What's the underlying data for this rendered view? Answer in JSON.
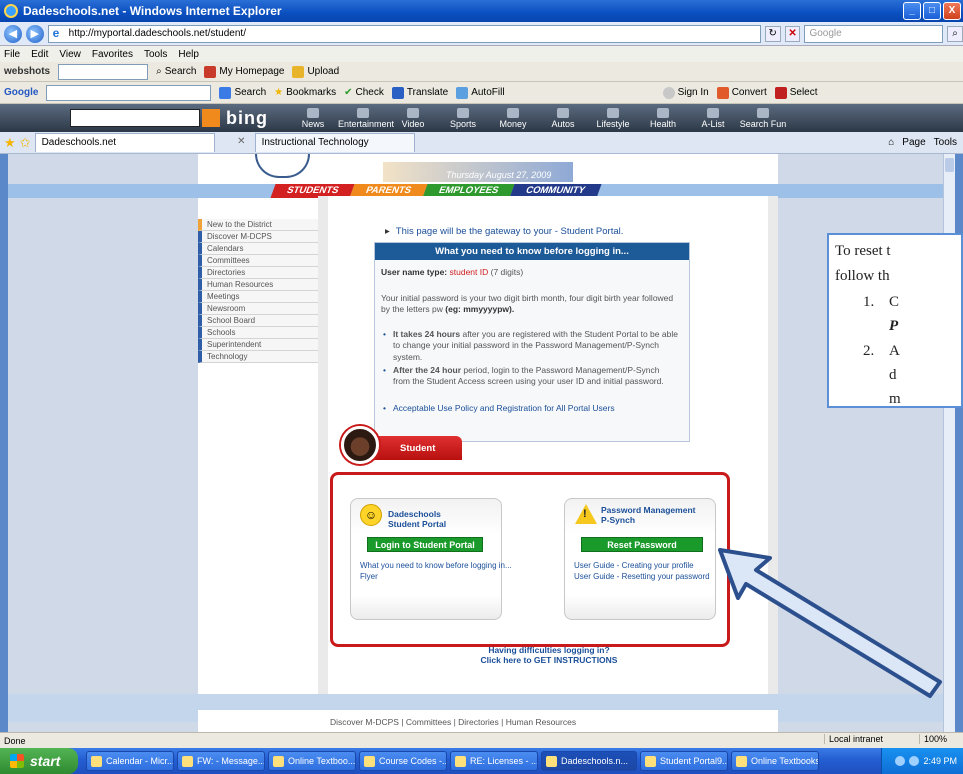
{
  "window": {
    "title": "Dadeschools.net - Windows Internet Explorer",
    "buttons": [
      "_",
      "□",
      "X"
    ]
  },
  "address": {
    "url": "http://myportal.dadeschools.net/student/",
    "search_placeholder": "Google"
  },
  "menu": [
    "File",
    "Edit",
    "View",
    "Favorites",
    "Tools",
    "Help"
  ],
  "toolbar1": {
    "brand": "webshots",
    "search": "Search",
    "homepage": "My Homepage",
    "upload": "Upload"
  },
  "toolbar2": {
    "brand": "Google",
    "search": "Search",
    "bookmarks": "Bookmarks",
    "check": "Check",
    "translate": "Translate",
    "autofill": "AutoFill",
    "signin": "Sign In",
    "convert": "Convert",
    "select": "Select"
  },
  "bing": {
    "logo": "bing",
    "tabs": [
      "News",
      "Entertainment",
      "Video",
      "Sports",
      "Money",
      "Autos",
      "Lifestyle",
      "Health",
      "A-List",
      "Search Fun"
    ]
  },
  "tabs": {
    "active": "Dadeschools.net",
    "other": "Instructional Technology",
    "tools": [
      "Page",
      "Tools"
    ]
  },
  "site": {
    "date": "Thursday August 27, 2009",
    "nav": [
      "STUDENTS",
      "PARENTS",
      "EMPLOYEES",
      "COMMUNITY"
    ],
    "side_menu": [
      "New to the District",
      "Discover M-DCPS",
      "Calendars",
      "Committees",
      "Directories",
      "Human Resources",
      "Meetings",
      "Newsroom",
      "School Board",
      "Schools",
      "Superintendent",
      "Technology"
    ],
    "gateway": "This page will be the gateway to your - Student Portal.",
    "info": {
      "heading": "What you need to know before logging in...",
      "username_label": "User name type:",
      "username_value": "student ID",
      "username_suffix": "(7 digits)",
      "password_text": "Your initial password is your two digit birth month, four digit birth year followed by the letters pw",
      "password_example": "(eg: mmyyyypw).",
      "bullet1_bold": "It takes 24 hours",
      "bullet1": "after you are registered with the Student Portal to be able to change your initial password in the Password Management/P-Synch system.",
      "bullet2_bold": "After the 24 hour",
      "bullet2": "period, login to the Password Management/P-Synch from the Student Access screen using your user ID and initial password.",
      "bullet3": "Acceptable Use Policy and Registration for All Portal Users"
    },
    "student": {
      "tab": "Student",
      "left_title_1": "Dadeschools",
      "left_title_2": "Student Portal",
      "left_button": "Login to Student Portal",
      "left_link1": "What you need to know before logging in...",
      "left_link2": "Flyer",
      "right_title_1": "Password Management",
      "right_title_2": "P-Synch",
      "right_button": "Reset Password",
      "right_link1": "User Guide - Creating your profile",
      "right_link2": "User Guide - Resetting your password"
    },
    "difficulty_1": "Having difficulties logging in?",
    "difficulty_2": "Click here to GET INSTRUCTIONS",
    "footer": "Discover M-DCPS  |  Committees  |  Directories  |  Human Resources"
  },
  "callout": {
    "line1": "To reset t",
    "line2": "follow th",
    "item1_num": "1.",
    "item1_a": "C",
    "item1_b": "P",
    "item2_num": "2.",
    "item2_a": "A",
    "item2_b": "d",
    "item2_c": "m"
  },
  "status": {
    "left": "Done",
    "zone": "Local intranet",
    "zoom": "100%"
  },
  "taskbar": {
    "start": "start",
    "tasks": [
      "Calendar - Micr...",
      "FW: - Message...",
      "Online Textboo...",
      "Course Codes -...",
      "RE: Licenses - ...",
      "Dadeschools.n...",
      "Student Portal9...",
      "Online Textbooks"
    ],
    "clock": "2:49 PM"
  },
  "colors": {
    "accent": "#1d5a98",
    "student_red": "#c81a1a",
    "button_green": "#1a9a2a",
    "callout_border": "#5b8fd6"
  }
}
